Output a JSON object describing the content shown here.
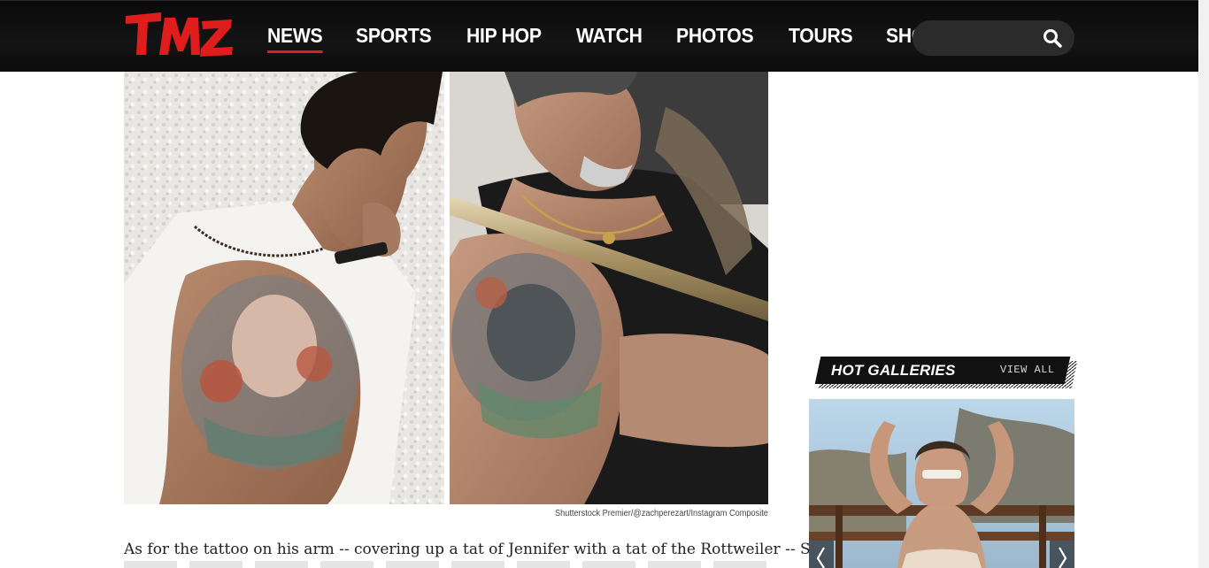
{
  "header": {
    "logo_text": "TMZ",
    "nav": [
      "NEWS",
      "SPORTS",
      "HIP HOP",
      "WATCH",
      "PHOTOS",
      "TOURS",
      "SHOP"
    ],
    "active_nav": "NEWS",
    "search": {
      "value": "",
      "placeholder": ""
    }
  },
  "article": {
    "photo_credit": "Shutterstock Premier/@zachperezart/Instagram Composite",
    "body_line": "As for the tattoo on his arm -- covering up a tat of Jennifer with a tat of the Rottweiler -- Sly"
  },
  "sidebar": {
    "hot_galleries_title": "HOT GALLERIES",
    "view_all_label": "VIEW ALL"
  },
  "colors": {
    "accent": "#e01d1d",
    "header_bg": "#111111",
    "search_bg": "#2b2b2b"
  },
  "icons": [
    "search-icon",
    "chevron-left-icon",
    "chevron-right-icon"
  ]
}
